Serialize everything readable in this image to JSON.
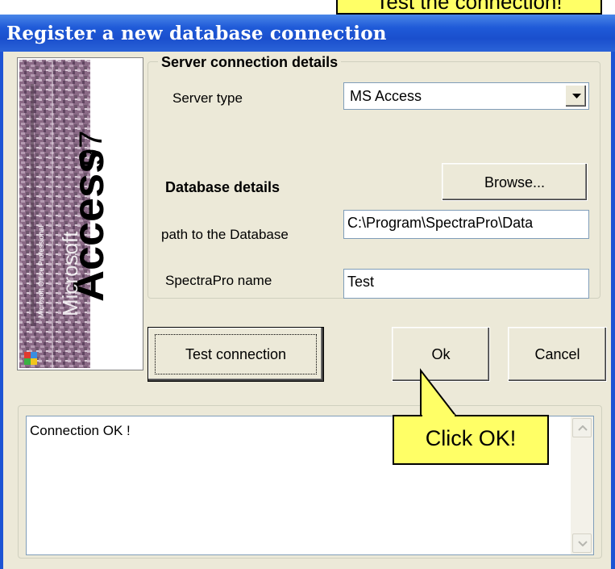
{
  "window": {
    "title": "Register a new database connection"
  },
  "side_image": {
    "brand": "Microsoft",
    "product": "Access",
    "version": "97",
    "tagline": "Microsoft Office Professional"
  },
  "server": {
    "group_title": "Server connection details",
    "type_label": "Server type",
    "type_value": "MS Access"
  },
  "database": {
    "heading": "Database details",
    "browse_label": "Browse...",
    "path_label": "path to the Database",
    "path_value": "C:\\Program\\SpectraPro\\Data",
    "name_label": "SpectraPro name",
    "name_value": "Test"
  },
  "buttons": {
    "test_connection": "Test connection",
    "ok": "Ok",
    "cancel": "Cancel"
  },
  "log": {
    "message": "Connection OK !"
  },
  "callouts": {
    "top": "Test the connection!",
    "ok": "Click OK!"
  },
  "colors": {
    "titlebar": "#1f5ad8",
    "dialog_bg": "#ece9d8",
    "callout_bg": "#ffff66"
  }
}
